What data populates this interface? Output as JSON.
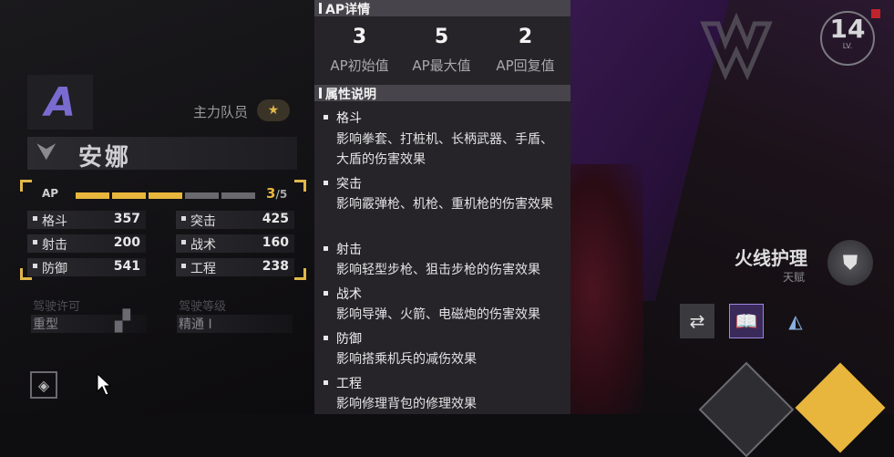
{
  "character": {
    "rank": "A",
    "role": "主力队员",
    "name": "安娜",
    "ap": {
      "label": "AP",
      "current": "3",
      "max": "/5",
      "filled": 3,
      "total": 5
    },
    "stats": [
      {
        "name": "格斗",
        "value": "357"
      },
      {
        "name": "突击",
        "value": "425"
      },
      {
        "name": "射击",
        "value": "200"
      },
      {
        "name": "战术",
        "value": "160"
      },
      {
        "name": "防御",
        "value": "541"
      },
      {
        "name": "工程",
        "value": "238"
      }
    ],
    "license_label": "驾驶许可",
    "license_value": "重型",
    "level_label": "驾驶等级",
    "level_value": "精通 I"
  },
  "popup": {
    "ap_header": "AP详情",
    "ap_items": [
      {
        "value": "3",
        "label": "AP初始值"
      },
      {
        "value": "5",
        "label": "AP最大值"
      },
      {
        "value": "2",
        "label": "AP回复值"
      }
    ],
    "attr_header": "属性说明",
    "attributes": [
      {
        "title": "格斗",
        "desc": "影响拳套、打桩机、长柄武器、手盾、大盾的伤害效果"
      },
      {
        "title": "突击",
        "desc": "影响霰弹枪、机枪、重机枪的伤害效果"
      },
      {
        "title": "射击",
        "desc": "影响轻型步枪、狙击步枪的伤害效果"
      },
      {
        "title": "战术",
        "desc": "影响导弹、火箭、电磁炮的伤害效果"
      },
      {
        "title": "防御",
        "desc": "影响搭乘机兵的减伤效果"
      },
      {
        "title": "工程",
        "desc": "影响修理背包的修理效果"
      }
    ]
  },
  "player": {
    "level": "14",
    "level_caption": "LV."
  },
  "skill": {
    "name": "火线护理",
    "tag": "天赋"
  },
  "colors": {
    "accent": "#e8b63c",
    "panel": "#262429",
    "header": "#47454b",
    "rank": "#7a6bd0"
  },
  "icons": [
    "layers-icon",
    "swap-icon",
    "book-icon",
    "triangle-emblem-icon",
    "shield-skill-icon",
    "chip-icon",
    "circuit-icon"
  ]
}
